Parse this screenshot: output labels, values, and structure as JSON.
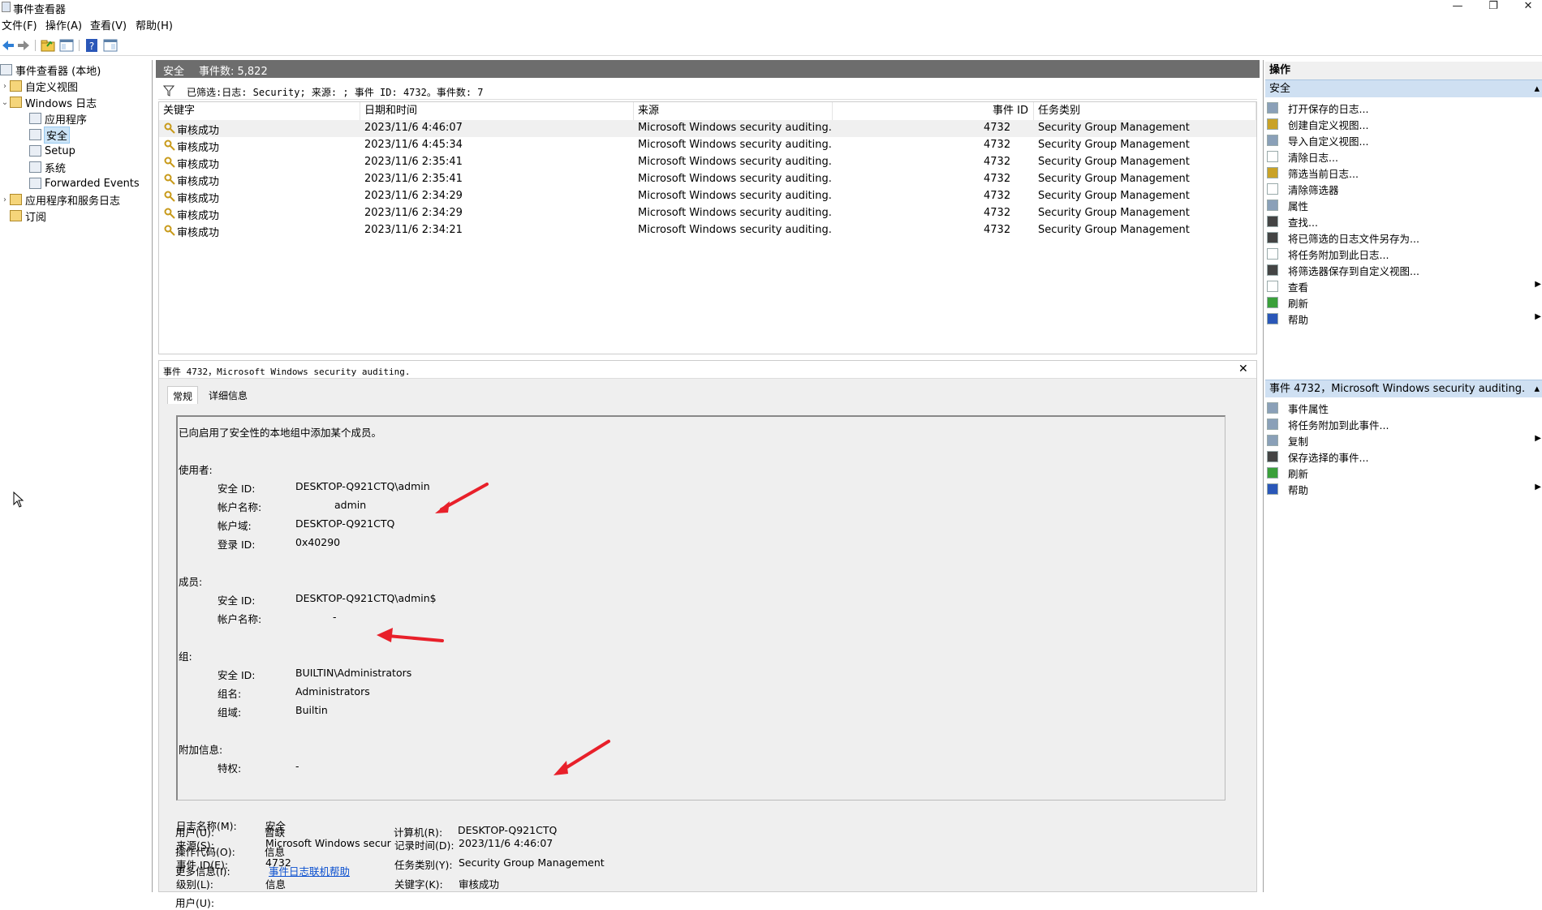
{
  "window": {
    "title": "事件查看器",
    "controls": [
      "—",
      "❐",
      "✕"
    ]
  },
  "menu": [
    "文件(F)",
    "操作(A)",
    "查看(V)",
    "帮助(H)"
  ],
  "tree": {
    "root": "事件查看器 (本地)",
    "custom_views": "自定义视图",
    "windows_logs": "Windows 日志",
    "windows_children": [
      "应用程序",
      "安全",
      "Setup",
      "系统",
      "Forwarded Events"
    ],
    "app_services": "应用程序和服务日志",
    "subscriptions": "订阅"
  },
  "main_header": {
    "log": "安全",
    "count": "事件数: 5,822"
  },
  "filter_text": "已筛选:日志: Security; 来源: ; 事件 ID: 4732。事件数: 7",
  "columns": [
    "关键字",
    "日期和时间",
    "来源",
    "事件 ID",
    "任务类别"
  ],
  "events": [
    {
      "keyword": "审核成功",
      "datetime": "2023/11/6 4:46:07",
      "source": "Microsoft Windows security auditing.",
      "id": "4732",
      "category": "Security Group Management"
    },
    {
      "keyword": "审核成功",
      "datetime": "2023/11/6 4:45:34",
      "source": "Microsoft Windows security auditing.",
      "id": "4732",
      "category": "Security Group Management"
    },
    {
      "keyword": "审核成功",
      "datetime": "2023/11/6 2:35:41",
      "source": "Microsoft Windows security auditing.",
      "id": "4732",
      "category": "Security Group Management"
    },
    {
      "keyword": "审核成功",
      "datetime": "2023/11/6 2:35:41",
      "source": "Microsoft Windows security auditing.",
      "id": "4732",
      "category": "Security Group Management"
    },
    {
      "keyword": "审核成功",
      "datetime": "2023/11/6 2:34:29",
      "source": "Microsoft Windows security auditing.",
      "id": "4732",
      "category": "Security Group Management"
    },
    {
      "keyword": "审核成功",
      "datetime": "2023/11/6 2:34:29",
      "source": "Microsoft Windows security auditing.",
      "id": "4732",
      "category": "Security Group Management"
    },
    {
      "keyword": "审核成功",
      "datetime": "2023/11/6 2:34:21",
      "source": "Microsoft Windows security auditing.",
      "id": "4732",
      "category": "Security Group Management"
    }
  ],
  "detail": {
    "title": "事件 4732，Microsoft Windows security auditing.",
    "close": "✕",
    "tabs": [
      "常规",
      "详细信息"
    ],
    "message": {
      "intro": "已向启用了安全性的本地组中添加某个成员。",
      "subject_label": "使用者:",
      "subject": [
        {
          "k": "安全 ID:",
          "v": "DESKTOP-Q921CTQ\\admin"
        },
        {
          "k": "帐户名称:",
          "v": "admin"
        },
        {
          "k": "帐户域:",
          "v": "DESKTOP-Q921CTQ"
        },
        {
          "k": "登录 ID:",
          "v": "0x40290"
        }
      ],
      "member_label": "成员:",
      "member": [
        {
          "k": "安全 ID:",
          "v": "DESKTOP-Q921CTQ\\admin$"
        },
        {
          "k": "帐户名称:",
          "v": "-"
        }
      ],
      "group_label": "组:",
      "group": [
        {
          "k": "安全 ID:",
          "v": "BUILTIN\\Administrators"
        },
        {
          "k": "组名:",
          "v": "Administrators"
        },
        {
          "k": "组域:",
          "v": "Builtin"
        }
      ],
      "extra_label": "附加信息:",
      "extra": [
        {
          "k": "特权:",
          "v": "-"
        }
      ]
    },
    "fields": {
      "log_name_label": "日志名称(M):",
      "log_name": "安全",
      "source_label": "来源(S):",
      "source": "Microsoft Windows secur",
      "logged_label": "记录时间(D):",
      "logged": "2023/11/6 4:46:07",
      "event_id_label": "事件 ID(E):",
      "event_id": "4732",
      "task_label": "任务类别(Y):",
      "task": "Security Group Management",
      "level_label": "级别(L):",
      "level": "信息",
      "keywords_label": "关键字(K):",
      "keywords": "审核成功",
      "user_label": "用户(U):",
      "user": "暂缺",
      "computer_label": "计算机(R):",
      "computer": "DESKTOP-Q921CTQ",
      "opcode_label": "操作代码(O):",
      "opcode": "信息",
      "more_label": "更多信息(I):",
      "more": "事件日志联机帮助"
    }
  },
  "actions": {
    "header": "操作",
    "section1": "安全",
    "items1": [
      "打开保存的日志...",
      "创建自定义视图...",
      "导入自定义视图...",
      "清除日志...",
      "筛选当前日志...",
      "清除筛选器",
      "属性",
      "查找...",
      "将已筛选的日志文件另存为...",
      "将任务附加到此日志...",
      "将筛选器保存到自定义视图...",
      "查看",
      "刷新",
      "帮助"
    ],
    "section2": "事件 4732，Microsoft Windows security auditing.",
    "items2": [
      "事件属性",
      "将任务附加到此事件...",
      "复制",
      "保存选择的事件...",
      "刷新",
      "帮助"
    ]
  },
  "colors": {
    "header_gray": "#6d6d6d",
    "action_section_blue": "#cfe0f2",
    "annotation_arrow": "#e8202a"
  }
}
